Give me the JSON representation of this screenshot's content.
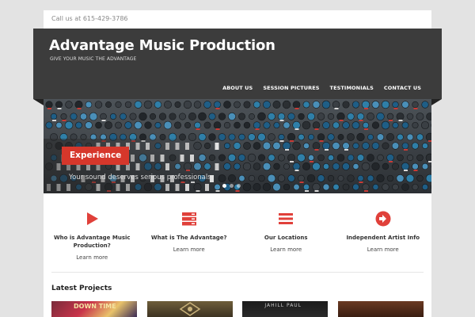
{
  "topbar": {
    "phone_text": "Call us at 615-429-3786"
  },
  "header": {
    "title": "Advantage Music Production",
    "tagline": "GIVE YOUR MUSIC THE ADVANTAGE",
    "bg_color": "#3c3c3c"
  },
  "nav": {
    "items": [
      {
        "label": "ABOUT US"
      },
      {
        "label": "SESSION PICTURES"
      },
      {
        "label": "TESTIMONIALS"
      },
      {
        "label": "CONTACT US"
      }
    ]
  },
  "slider": {
    "caption": "Experience",
    "subcaption": "Your sound deserves serious professionals",
    "slide_count": 3,
    "active_slide": 1,
    "accent_color": "#d6372b"
  },
  "features": [
    {
      "icon": "play-icon",
      "title": "Who is Advantage Music Production?",
      "link": "Learn more"
    },
    {
      "icon": "server-icon",
      "title": "What is The Advantage?",
      "link": "Learn more"
    },
    {
      "icon": "list-icon",
      "title": "Our Locations",
      "link": "Learn more"
    },
    {
      "icon": "arrow-circle-icon",
      "title": "Independent Artist Info",
      "link": "Learn more"
    }
  ],
  "icon_color": "#e0403a",
  "latest": {
    "heading": "Latest Projects",
    "items": [
      {
        "art_text": "DOWN TIME"
      },
      {
        "art_text": ""
      },
      {
        "art_text": "JAHILL PAUL"
      },
      {
        "art_text": ""
      }
    ]
  }
}
